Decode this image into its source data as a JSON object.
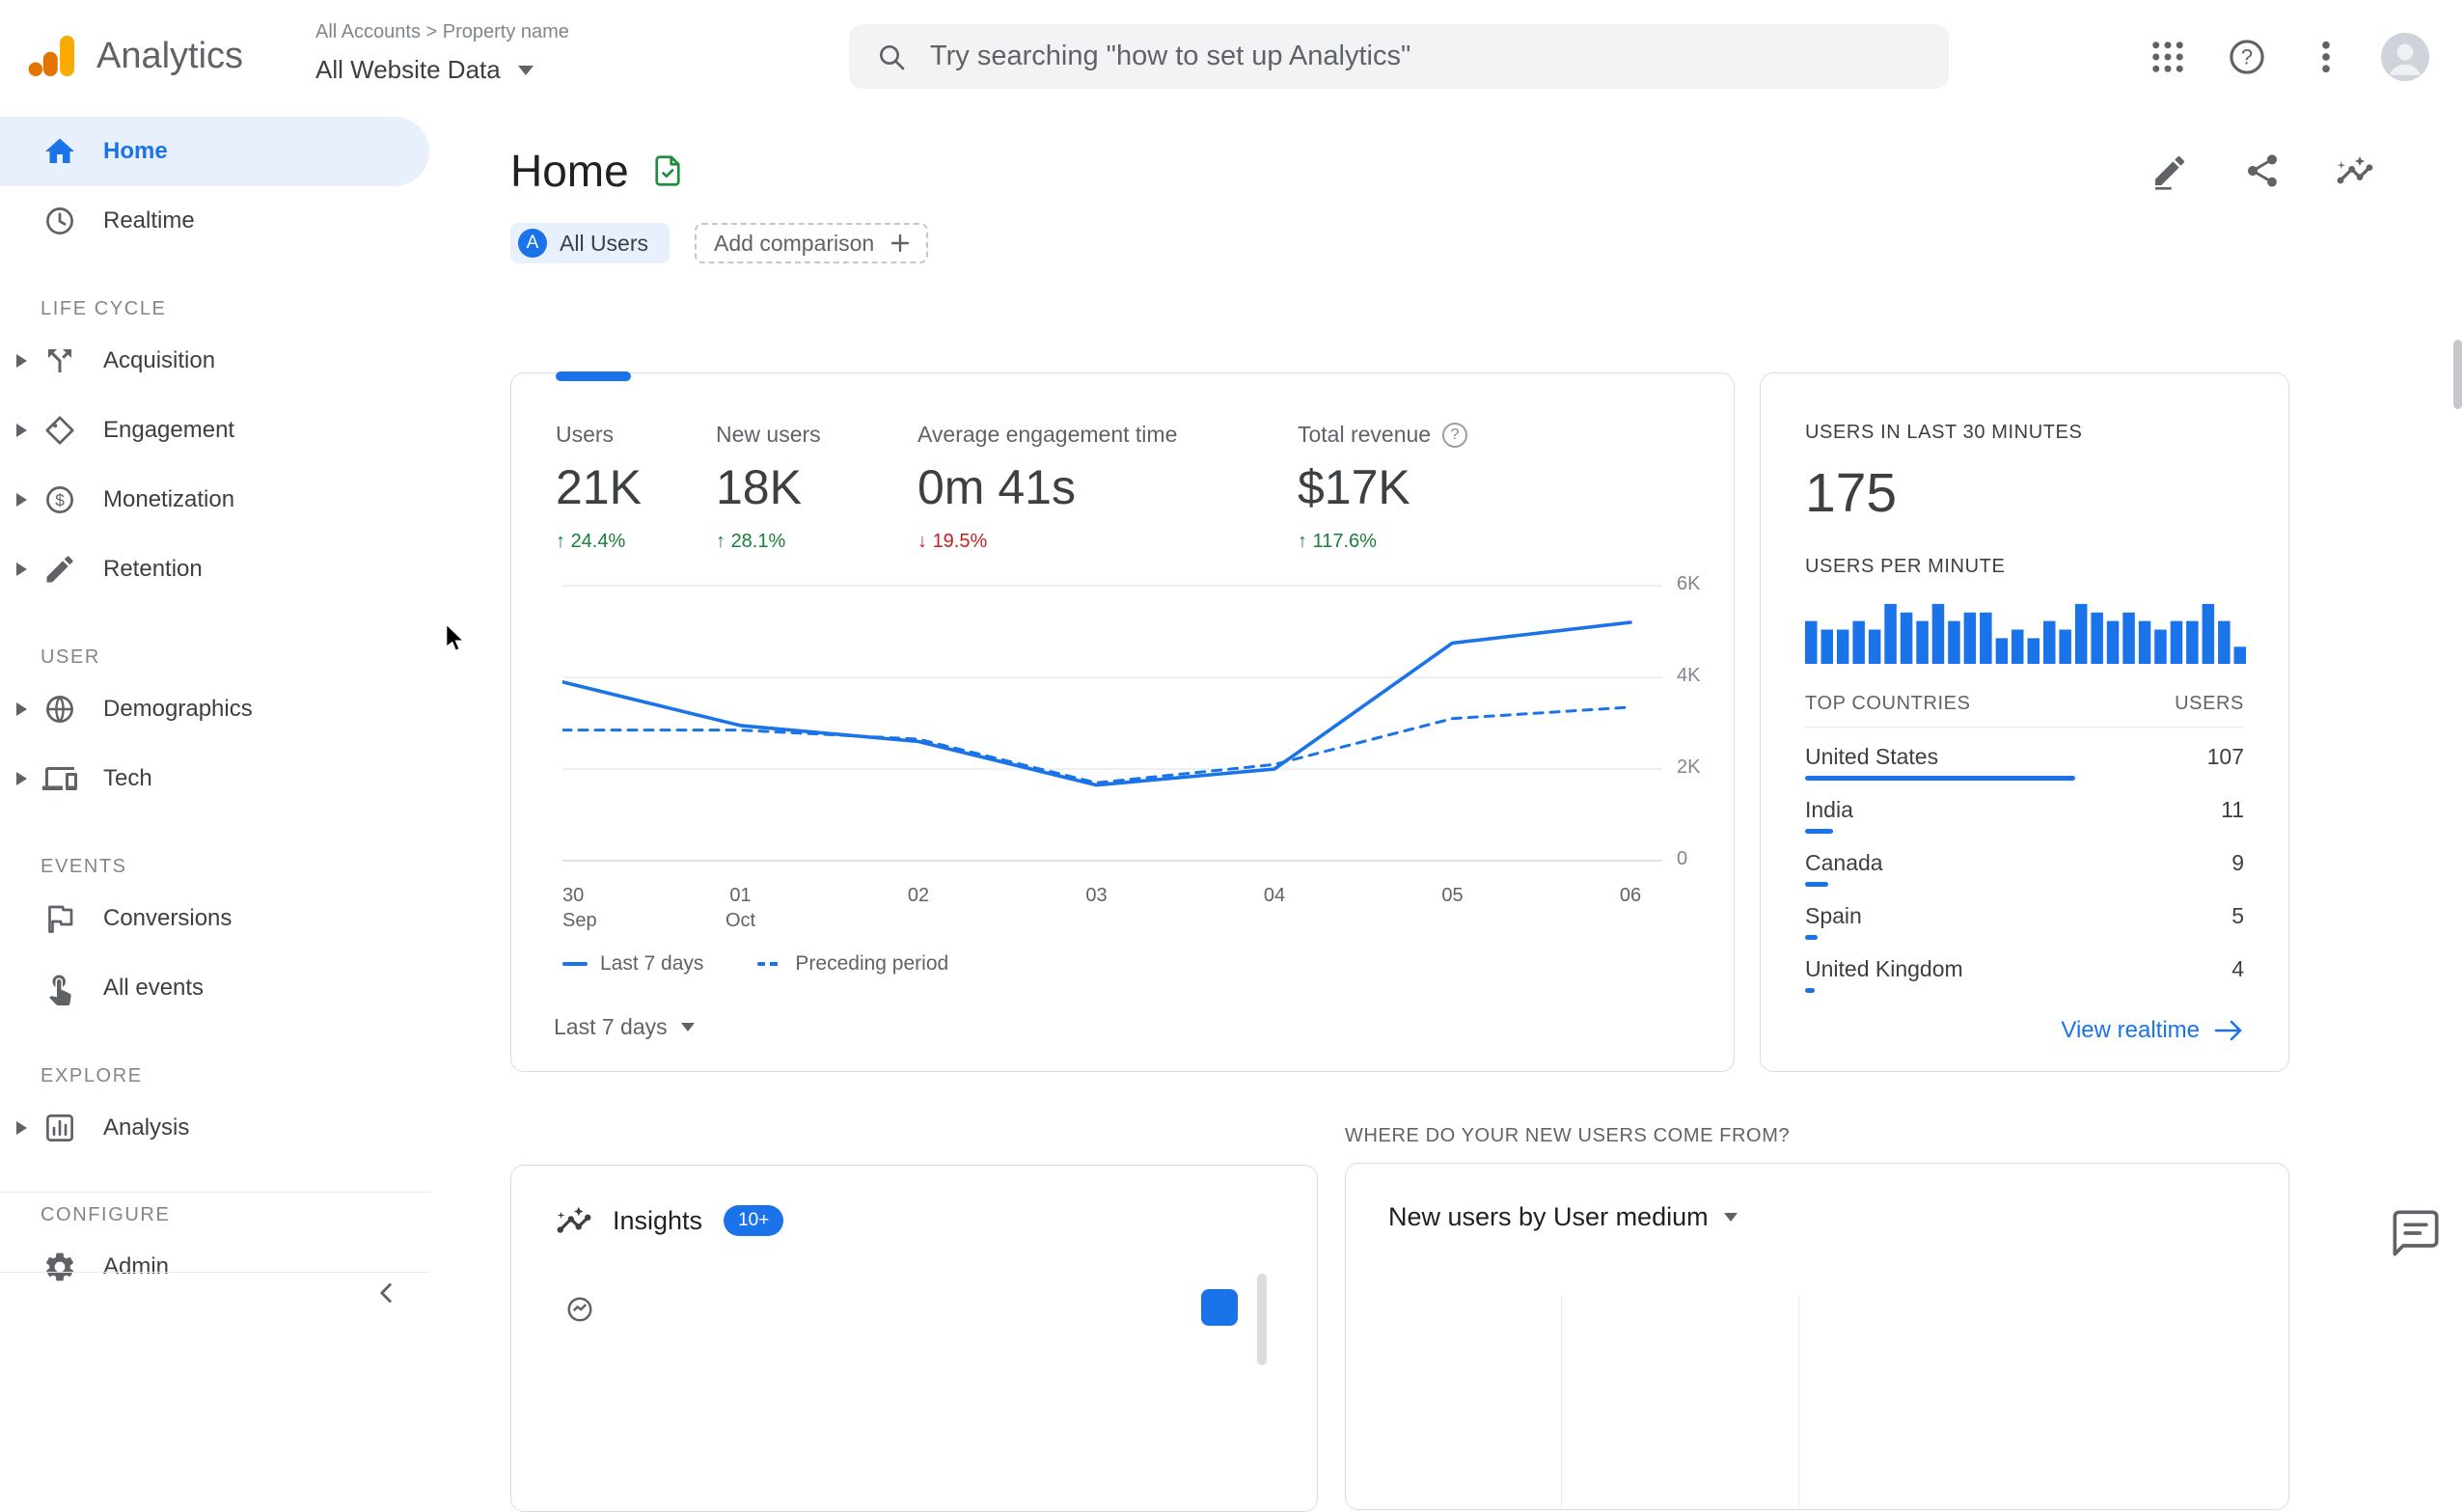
{
  "topbar": {
    "app_name": "Analytics",
    "breadcrumb": "All Accounts > Property name",
    "account_selector": "All Website Data",
    "search_placeholder": "Try searching \"how to set up Analytics\"",
    "help_glyph": "?"
  },
  "sidebar": {
    "top_items": [
      {
        "label": "Home",
        "icon": "home-icon",
        "active": true
      },
      {
        "label": "Realtime",
        "icon": "clock-icon",
        "active": false
      }
    ],
    "groups": [
      {
        "header": "LIFE CYCLE",
        "items": [
          {
            "label": "Acquisition",
            "icon": "acquisition-icon",
            "expandable": true
          },
          {
            "label": "Engagement",
            "icon": "engagement-icon",
            "expandable": true
          },
          {
            "label": "Monetization",
            "icon": "monetization-icon",
            "expandable": true
          },
          {
            "label": "Retention",
            "icon": "retention-icon",
            "expandable": true
          }
        ]
      },
      {
        "header": "USER",
        "items": [
          {
            "label": "Demographics",
            "icon": "demographics-icon",
            "expandable": true
          },
          {
            "label": "Tech",
            "icon": "tech-icon",
            "expandable": true
          }
        ]
      },
      {
        "header": "EVENTS",
        "items": [
          {
            "label": "Conversions",
            "icon": "conversions-icon",
            "expandable": false
          },
          {
            "label": "All events",
            "icon": "all-events-icon",
            "expandable": false
          }
        ]
      },
      {
        "header": "EXPLORE",
        "items": [
          {
            "label": "Analysis",
            "icon": "analysis-icon",
            "expandable": true
          }
        ]
      },
      {
        "header": "CONFIGURE",
        "items": [
          {
            "label": "Admin",
            "icon": "gear-icon",
            "expandable": false
          }
        ]
      }
    ]
  },
  "page": {
    "title": "Home",
    "audience_letter": "A",
    "audience_chip": "All Users",
    "add_comparison": "Add comparison"
  },
  "overview": {
    "metrics": [
      {
        "label": "Users",
        "value": "21K",
        "arrow": "↑",
        "delta": "24.4%",
        "direction": "up",
        "help": false
      },
      {
        "label": "New users",
        "value": "18K",
        "arrow": "↑",
        "delta": "28.1%",
        "direction": "up",
        "help": false
      },
      {
        "label": "Average engagement time",
        "value": "0m 41s",
        "arrow": "↓",
        "delta": "19.5%",
        "direction": "down",
        "help": false
      },
      {
        "label": "Total revenue",
        "value": "$17K",
        "arrow": "↑",
        "delta": "117.6%",
        "direction": "up",
        "help": true
      }
    ],
    "range_selector": "Last 7 days"
  },
  "realtime": {
    "title": "USERS IN LAST 30 MINUTES",
    "value": "175",
    "per_minute_label": "USERS PER MINUTE",
    "link_label": "View realtime"
  },
  "insights": {
    "title": "Insights",
    "badge": "10+"
  },
  "new_users": {
    "section_heading": "WHERE DO YOUR NEW USERS COME FROM?",
    "card_title": "New users by User medium"
  },
  "colors": {
    "accent": "#1a73e8",
    "positive": "#188038",
    "negative": "#c5221f",
    "chip_bg": "#e8f0fe"
  },
  "chart_data": [
    {
      "type": "line",
      "title": "Users over time",
      "x": [
        "30 Sep",
        "01 Oct",
        "02",
        "03",
        "04",
        "05",
        "06"
      ],
      "series": [
        {
          "name": "Last 7 days",
          "style": "solid",
          "values": [
            3900,
            2950,
            2600,
            1650,
            2000,
            4750,
            5200
          ]
        },
        {
          "name": "Preceding period",
          "style": "dashed",
          "values": [
            2850,
            2850,
            2650,
            1700,
            2100,
            3100,
            3350
          ]
        }
      ],
      "ylim": [
        0,
        6000
      ],
      "yticks": [
        {
          "v": 0,
          "label": "0"
        },
        {
          "v": 2000,
          "label": "2K"
        },
        {
          "v": 4000,
          "label": "4K"
        },
        {
          "v": 6000,
          "label": "6K"
        }
      ],
      "grid": true,
      "legend_position": "bottom"
    },
    {
      "type": "bar",
      "title": "Users per minute",
      "values": [
        5,
        4,
        4,
        5,
        4,
        7,
        6,
        5,
        7,
        5,
        6,
        6,
        3,
        4,
        3,
        5,
        4,
        7,
        6,
        5,
        6,
        5,
        4,
        5,
        5,
        7,
        5,
        2
      ],
      "ylim": [
        0,
        8
      ]
    },
    {
      "type": "table",
      "title": "Top countries by users (last 30 minutes)",
      "columns": [
        "TOP COUNTRIES",
        "USERS"
      ],
      "rows": [
        {
          "country": "United States",
          "users": 107
        },
        {
          "country": "India",
          "users": 11
        },
        {
          "country": "Canada",
          "users": 9
        },
        {
          "country": "Spain",
          "users": 5
        },
        {
          "country": "United Kingdom",
          "users": 4
        }
      ]
    }
  ]
}
